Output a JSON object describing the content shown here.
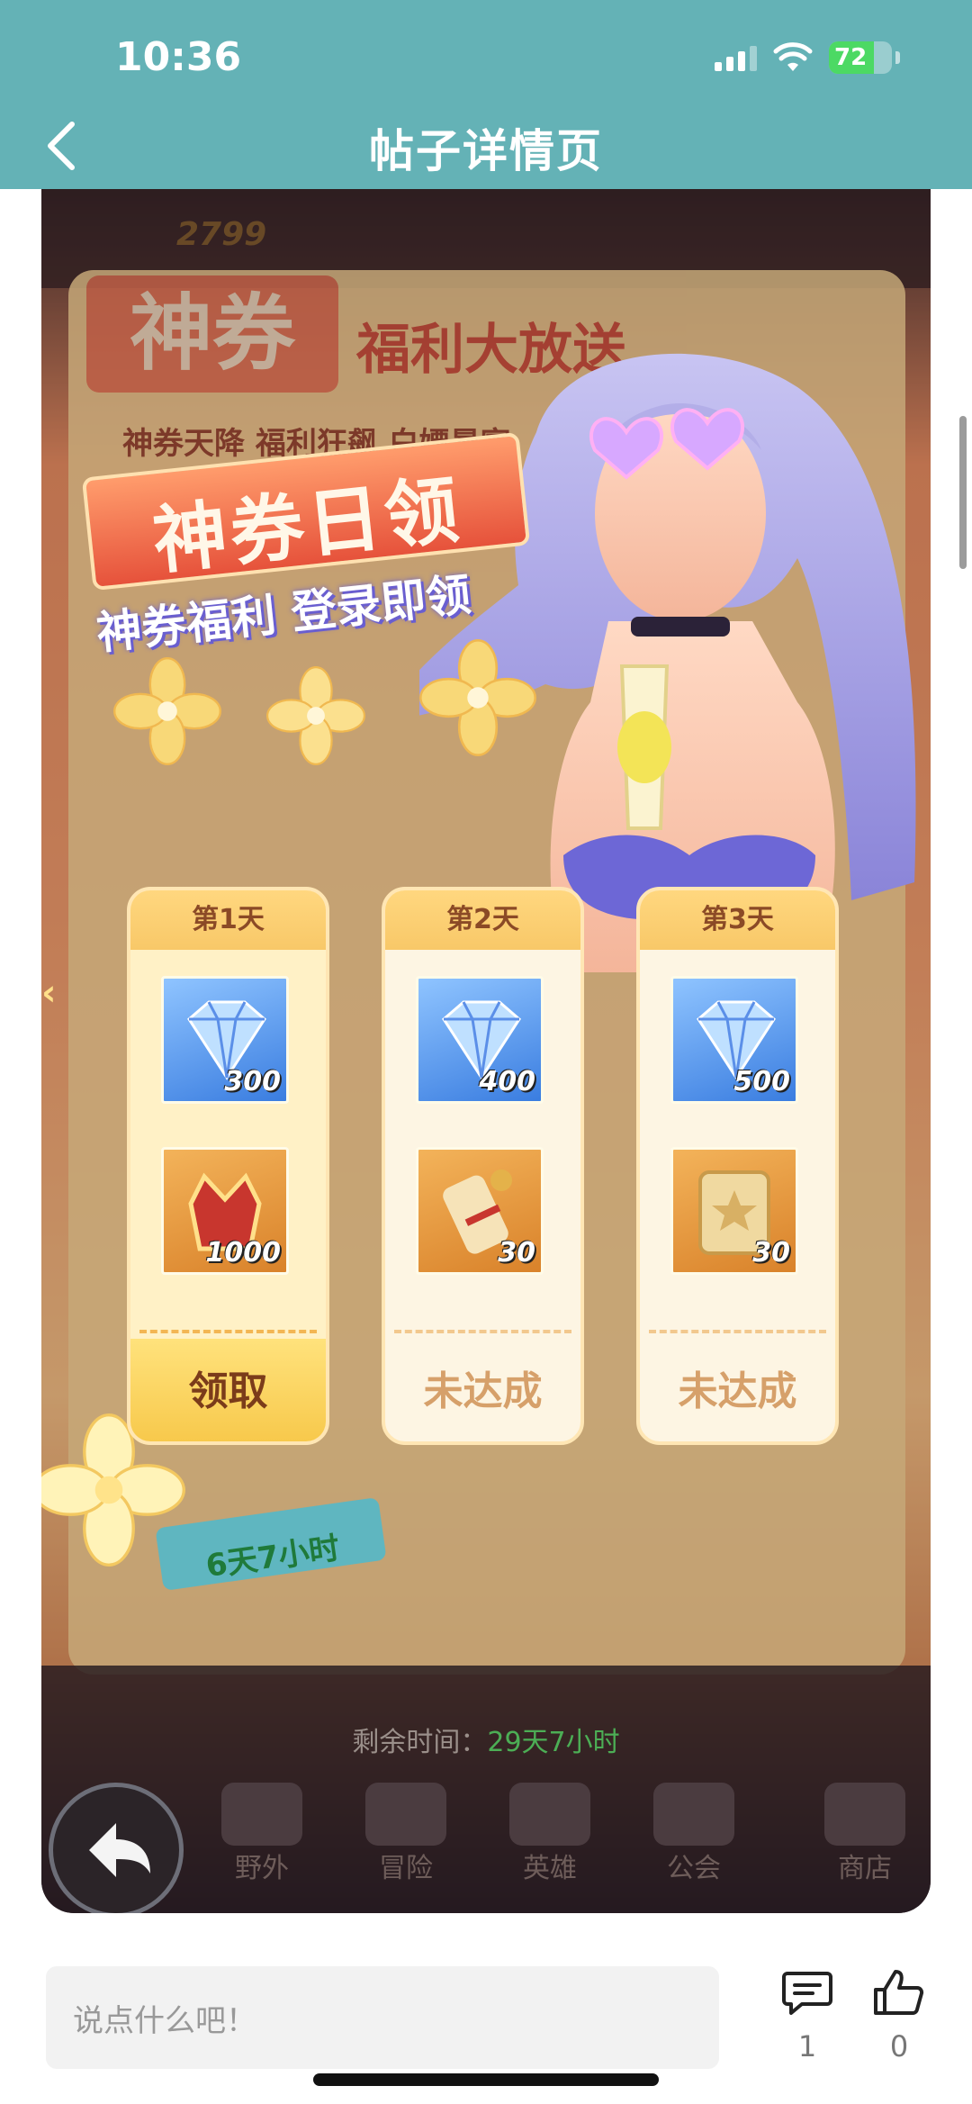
{
  "status_bar": {
    "time": "10:36",
    "battery": "72"
  },
  "header": {
    "title": "帖子详情页"
  },
  "post_image": {
    "top_coin": "2799",
    "bg_title": "神券",
    "bg_title_2": "福利大放送",
    "bg_subtitle": "神券天降 福利狂飙 白嫖暴富",
    "banner_title": "神券日领",
    "banner_subtitle": "神券福利 登录即领",
    "cards": [
      {
        "day": "第1天",
        "gem_qty": "300",
        "item_qty": "1000",
        "button": "领取"
      },
      {
        "day": "第2天",
        "gem_qty": "400",
        "item_qty": "30",
        "button": "未达成"
      },
      {
        "day": "第3天",
        "gem_qty": "500",
        "item_qty": "30",
        "button": "未达成"
      }
    ],
    "small_timer": "6天7小时",
    "remaining_label": "剩余时间：",
    "remaining_value": "29天7小时",
    "nav": [
      "野外",
      "冒险",
      "英雄",
      "公会",
      "商店"
    ]
  },
  "comment_bar": {
    "placeholder": "说点什么吧！",
    "comment_count": "1",
    "like_count": "0"
  },
  "colors": {
    "header_bg": "#64b2b6",
    "accent_orange": "#e6523b",
    "timer_green": "#4cae55"
  }
}
